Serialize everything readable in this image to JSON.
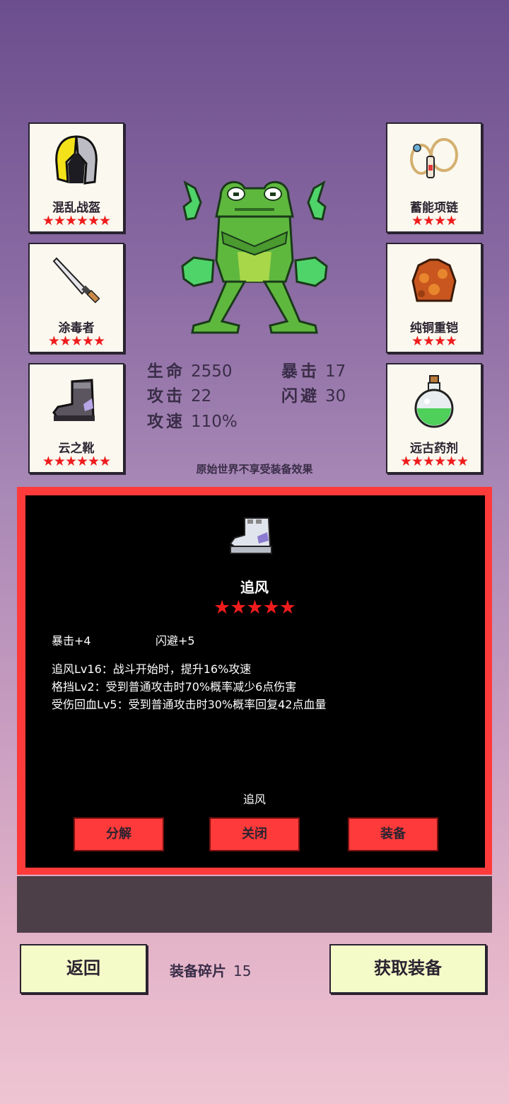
{
  "equipment": {
    "left": [
      {
        "name": "混乱战盔",
        "stars": "★★★★★★",
        "icon": "helmet-icon"
      },
      {
        "name": "涂毒者",
        "stars": "★★★★★",
        "icon": "dagger-icon"
      },
      {
        "name": "云之靴",
        "stars": "★★★★★★",
        "icon": "boots-icon"
      }
    ],
    "right": [
      {
        "name": "蓄能项链",
        "stars": "★★★★",
        "icon": "necklace-icon"
      },
      {
        "name": "纯铜重铠",
        "stars": "★★★★",
        "icon": "armor-icon"
      },
      {
        "name": "远古药剂",
        "stars": "★★★★★★",
        "icon": "potion-icon"
      }
    ]
  },
  "stats": {
    "hp_label": "生命",
    "hp": "2550",
    "crit_label": "暴击",
    "crit": "17",
    "atk_label": "攻击",
    "atk": "22",
    "dodge_label": "闪避",
    "dodge": "30",
    "spd_label": "攻速",
    "spd": "110%"
  },
  "note": "原始世界不享受装备效果",
  "detail": {
    "title": "追风",
    "stars": "★★★★★",
    "attr1": "暴击+4",
    "attr2": "闪避+5",
    "skills": [
      "追风Lv16：战斗开始时，提升16%攻速",
      "格挡Lv2：受到普通攻击时70%概率减少6点伤害",
      "受伤回血Lv5：受到普通攻击时30%概率回复42点血量"
    ],
    "subtitle": "追风",
    "buttons": {
      "decompose": "分解",
      "close": "关闭",
      "equip": "装备"
    }
  },
  "footer": {
    "back": "返回",
    "shards_label": "装备碎片",
    "shards_count": "15",
    "get": "获取装备"
  },
  "colors": {
    "accent_red": "#ff3a3a",
    "star_red": "#ee1c1c",
    "button_yellow": "#f5fbc8"
  }
}
